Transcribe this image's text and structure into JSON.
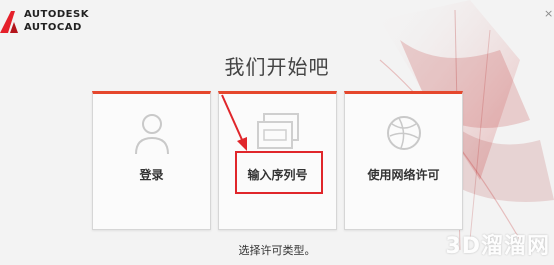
{
  "header": {
    "brand_line1": "AUTODESK",
    "brand_line2": "AUTOCAD",
    "close_glyph": "×"
  },
  "main": {
    "title": "我们开始吧",
    "subtitle": "选择许可类型。"
  },
  "cards": [
    {
      "label": "登录",
      "icon": "user-icon"
    },
    {
      "label": "输入序列号",
      "icon": "serial-window-icon"
    },
    {
      "label": "使用网络许可",
      "icon": "network-globe-icon"
    }
  ],
  "watermark": "3D溜溜网",
  "colors": {
    "accent": "#e5472d",
    "highlight": "#e0262b",
    "background": "#f3f3f3"
  }
}
